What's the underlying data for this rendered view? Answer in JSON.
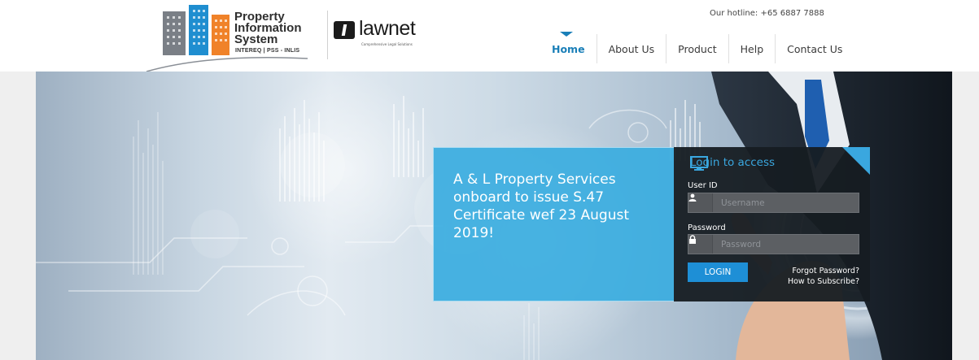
{
  "header": {
    "pis_logo": {
      "line1": "Property",
      "line2": "Information",
      "line3": "System",
      "sub": "INTEREQ | PSS - INLIS"
    },
    "lawnet_logo": {
      "word": "lawnet",
      "tagline": "Comprehensive Legal Solutions"
    },
    "hotline": "Our hotline: +65 6887 7888",
    "nav": [
      {
        "label": "Home",
        "active": true
      },
      {
        "label": "About Us"
      },
      {
        "label": "Product"
      },
      {
        "label": "Help"
      },
      {
        "label": "Contact Us"
      }
    ],
    "accent_color": "#1a7fb8"
  },
  "hero": {
    "announcement": "A & L Property Services onboard to issue S.47 Certificate wef 23 August 2019!",
    "panel_color": "#3aadE0"
  },
  "login": {
    "title": "Login to access",
    "title_icon": "monitor-icon",
    "user_label": "User ID",
    "user_placeholder": "Username",
    "user_icon": "user-icon",
    "password_label": "Password",
    "password_placeholder": "Password",
    "password_icon": "lock-icon",
    "button": "LOGIN",
    "forgot": "Forgot Password?",
    "subscribe": "How to Subscribe?"
  }
}
